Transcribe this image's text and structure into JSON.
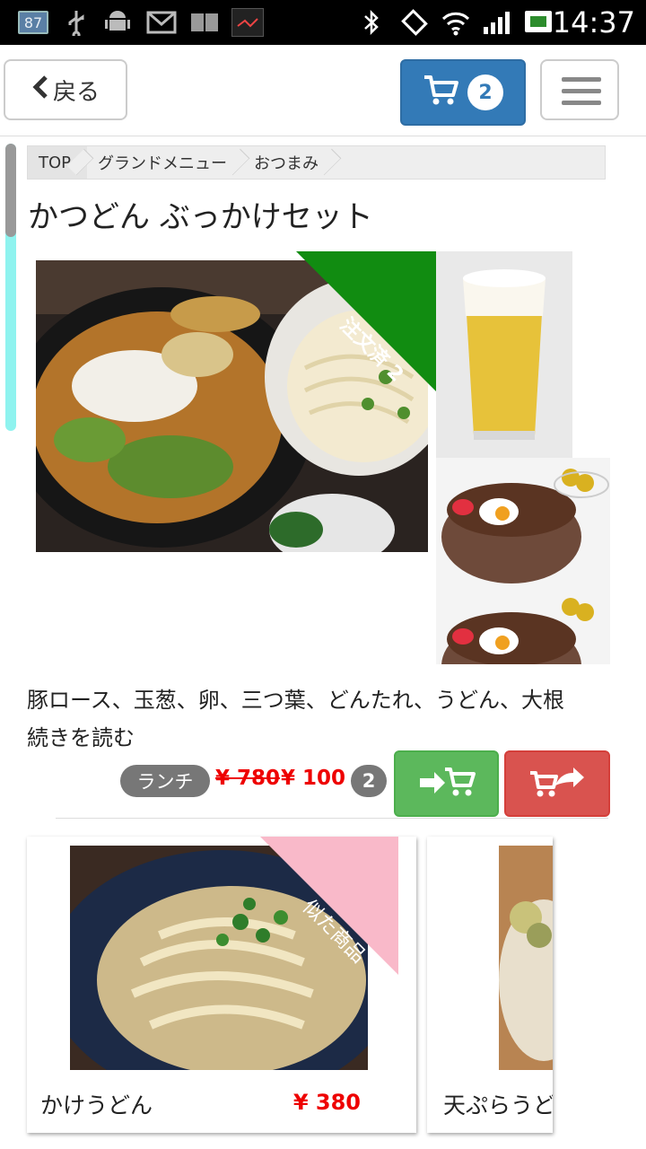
{
  "statusbar": {
    "notification_count": "87",
    "time": "14:37",
    "icons": [
      "usb-icon",
      "android-icon",
      "gmail-icon",
      "book-icon",
      "app-icon",
      "bluetooth-icon",
      "rotation-icon",
      "wifi-icon",
      "signal-icon",
      "battery-icon"
    ]
  },
  "navbar": {
    "back_label": "戻る",
    "cart_count": "2"
  },
  "breadcrumb": [
    "TOP",
    "グランドメニュー",
    "おつまみ"
  ],
  "product": {
    "title": "かつどん ぶっかけセット",
    "ordered_label": "注文済 2",
    "description": "豚ロース、玉葱、卵、三つ葉、どんたれ、うどん、大根",
    "read_more": "続きを読む",
    "tag": "ランチ",
    "price_original": "¥ 780",
    "price_sale": "¥ 100",
    "quantity": "2"
  },
  "similar": {
    "ribbon_label": "似た商品",
    "items": [
      {
        "name": "かけうどん",
        "price": "¥ 380"
      },
      {
        "name": "天ぷらうどん",
        "price": ""
      }
    ]
  },
  "colors": {
    "primary": "#337ab7",
    "success": "#5cb85c",
    "danger": "#d9534f",
    "ordered_ribbon": "#118c11",
    "similar_ribbon": "#f9b9c9",
    "price_red": "#ee0000"
  }
}
